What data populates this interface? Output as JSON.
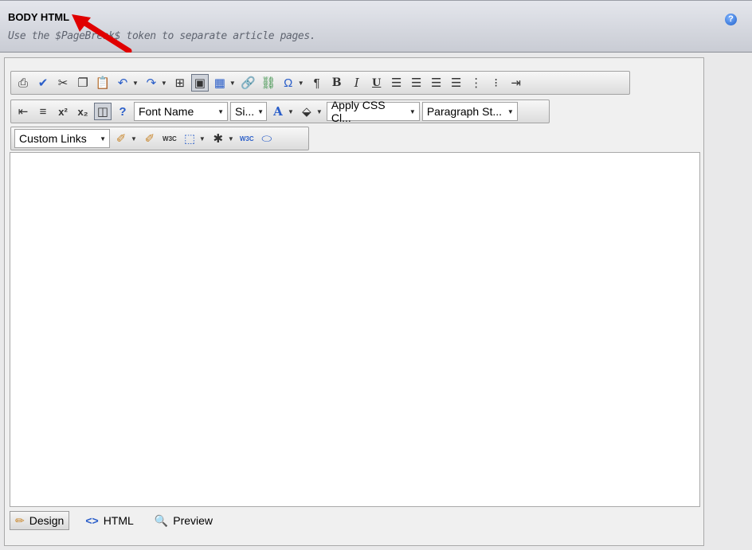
{
  "field": {
    "title": "BODY HTML",
    "hint": "Use the $PageBreak$ token to separate article pages.",
    "help_icon": "?"
  },
  "toolbar1": {
    "icons": [
      "print-icon",
      "spellcheck-icon",
      "cut-icon",
      "copy-icon",
      "paste-icon",
      "undo-icon",
      "redo-icon",
      "insert-element-icon",
      "image-manager-icon",
      "insert-table-icon",
      "hyperlink-icon",
      "remove-link-icon",
      "special-character-icon",
      "paragraph-mark-icon",
      "bold-icon",
      "italic-icon",
      "underline-icon",
      "align-left-icon",
      "align-center-icon",
      "align-right-icon",
      "justify-icon",
      "numbered-list-icon",
      "bulleted-list-icon",
      "indent-icon"
    ],
    "labels": {
      "omega": "Ω",
      "pilcrow": "¶",
      "bold": "B",
      "italic": "I",
      "underline": "U"
    }
  },
  "toolbar2": {
    "font_name": "Font Name",
    "font_size": "Si...",
    "css_class": "Apply CSS Cl...",
    "paragraph_style": "Paragraph St...",
    "superscript": "x²",
    "subscript": "x₂",
    "help": "?",
    "font_color_label": "A"
  },
  "toolbar3": {
    "custom_links": "Custom Links",
    "w3c_label": "W3C"
  },
  "modes": {
    "design": "Design",
    "html": "HTML",
    "preview": "Preview",
    "selected": "Design"
  },
  "colors": {
    "header_bg": "#d3d6de",
    "annotation_arrow": "#e00000",
    "link_blue": "#2a5ec9"
  }
}
